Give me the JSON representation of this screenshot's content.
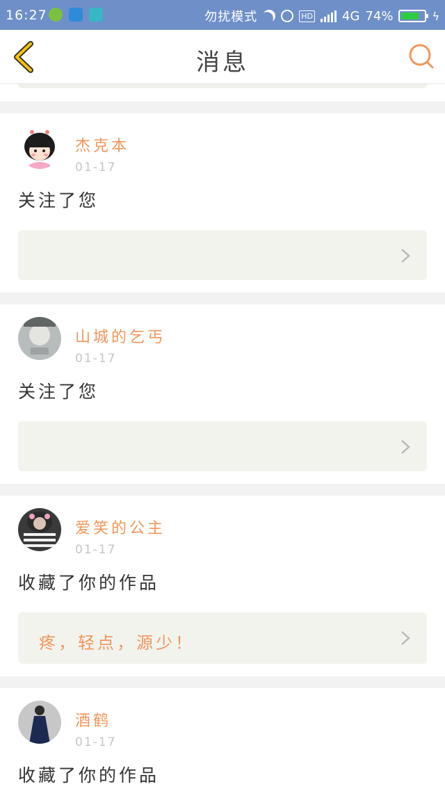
{
  "status_bar": {
    "time": "16:27",
    "mode": "勿扰模式",
    "hd": "HD",
    "network": "4G",
    "battery": "74%"
  },
  "header": {
    "title": "消息",
    "back_icon": "back-arrow-icon",
    "search_icon": "search-icon"
  },
  "colors": {
    "accent": "#f0965c",
    "status_bar": "#6f8fc9",
    "preview_bg": "#f3f3ee"
  },
  "messages": [
    {
      "name": "杰克本",
      "date": "01-17",
      "action": "关注了您",
      "preview": ""
    },
    {
      "name": "山城的乞丐",
      "date": "01-17",
      "action": "关注了您",
      "preview": ""
    },
    {
      "name": "爱笑的公主",
      "date": "01-17",
      "action": "收藏了你的作品",
      "preview": "疼，轻点，源少！"
    },
    {
      "name": "酒鹤",
      "date": "01-17",
      "action": "收藏了你的作品",
      "preview": ""
    }
  ]
}
